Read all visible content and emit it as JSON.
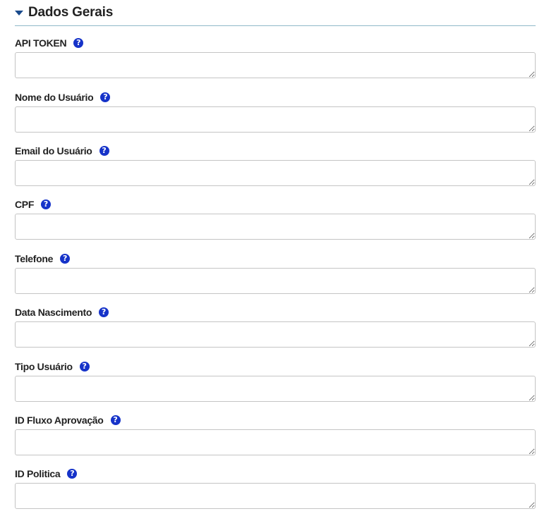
{
  "section": {
    "title": "Dados Gerais",
    "help_glyph": "?"
  },
  "fields": [
    {
      "label": "API TOKEN",
      "value": ""
    },
    {
      "label": "Nome do Usuário",
      "value": ""
    },
    {
      "label": "Email do Usuário",
      "value": ""
    },
    {
      "label": "CPF",
      "value": ""
    },
    {
      "label": "Telefone",
      "value": ""
    },
    {
      "label": "Data Nascimento",
      "value": ""
    },
    {
      "label": "Tipo Usuário",
      "value": ""
    },
    {
      "label": "ID Fluxo Aprovação",
      "value": ""
    },
    {
      "label": "ID Politica",
      "value": ""
    }
  ],
  "colors": {
    "caret": "#1a4a8c",
    "help_icon": "#1633c9",
    "divider": "#8fb8c8"
  },
  "icons": {
    "section_toggle": "caret-down-icon",
    "help": "question-circle-icon"
  }
}
